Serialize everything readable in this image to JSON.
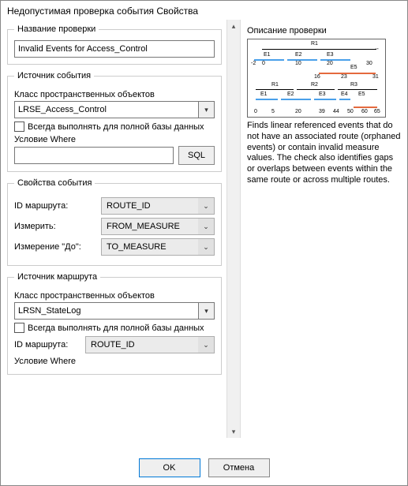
{
  "window": {
    "title": "Недопустимая проверка события Свойства"
  },
  "leftPanel": {
    "nameGroup": {
      "legend": "Название проверки",
      "value": "Invalid Events for Access_Control"
    },
    "eventSourceGroup": {
      "legend": "Источник события",
      "fcLabel": "Класс пространственных объектов",
      "fcValue": "LRSE_Access_Control",
      "fullDbCheckbox": "Всегда выполнять для полной базы данных",
      "whereLabel": "Условие Where",
      "whereValue": "",
      "sqlBtn": "SQL"
    },
    "eventPropsGroup": {
      "legend": "Свойства события",
      "routeIdLabel": "ID маршрута:",
      "routeIdValue": "ROUTE_ID",
      "measureLabel": "Измерить:",
      "measureValue": "FROM_MEASURE",
      "toMeasureLabel": "Измерение \"До\":",
      "toMeasureValue": "TO_MEASURE"
    },
    "routeSourceGroup": {
      "legend": "Источник маршрута",
      "fcLabel": "Класс пространственных объектов",
      "fcValue": "LRSN_StateLog",
      "fullDbCheckbox": "Всегда выполнять для полной базы данных",
      "routeIdLabel": "ID маршрута:",
      "routeIdValue": "ROUTE_ID",
      "whereLabel": "Условие Where"
    }
  },
  "rightPanel": {
    "descTitle": "Описание проверки",
    "descText": "Finds linear referenced events that do not have an associated route (orphaned events) or contain invalid measure values. The check also identifies gaps or overlaps between events within the same route or across multiple routes.",
    "diagram": {
      "r1": "R1",
      "r2": "R2",
      "r3": "R3",
      "e1": "E1",
      "e2": "E2",
      "e3": "E3",
      "e4": "E4",
      "e5": "E5",
      "ticks_top": [
        "-2",
        "0",
        "10",
        "20",
        "30"
      ],
      "ticks_mid": [
        "16",
        "23",
        "31"
      ],
      "ticks_bot": [
        "0",
        "5",
        "20",
        "39",
        "44",
        "50",
        "60",
        "65"
      ]
    }
  },
  "buttons": {
    "ok": "OK",
    "cancel": "Отмена"
  }
}
